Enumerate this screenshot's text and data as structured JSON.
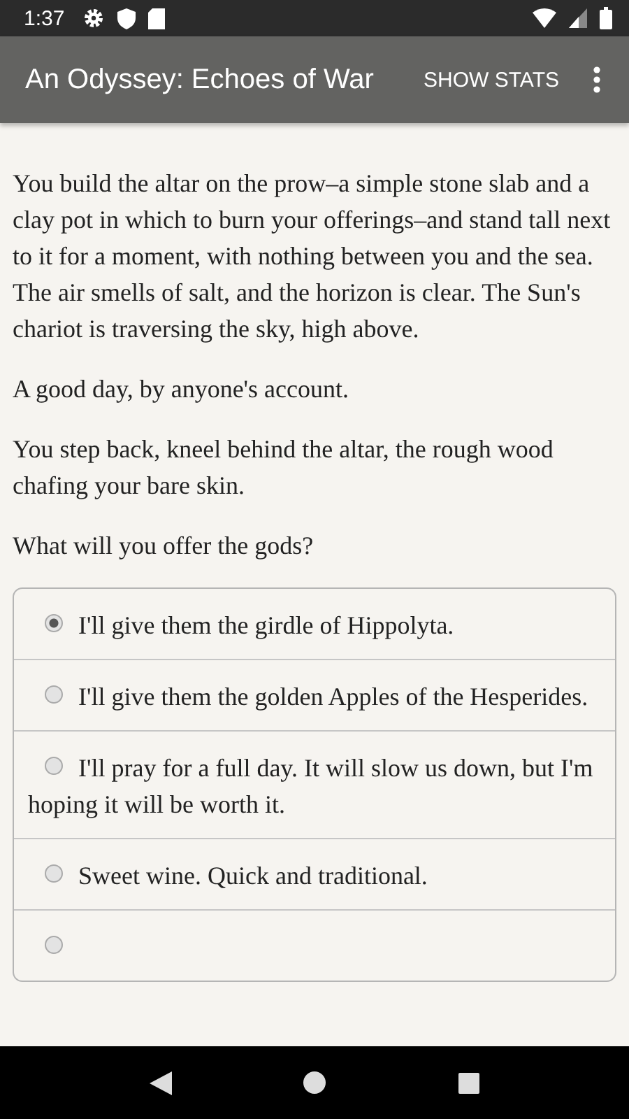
{
  "status_bar": {
    "time": "1:37"
  },
  "app_bar": {
    "title": "An Odyssey: Echoes of War",
    "action": "SHOW STATS"
  },
  "paragraphs": [
    "You build the altar on the prow–a simple stone slab and a clay pot in which to burn your offerings–and stand tall next to it for a moment, with nothing between you and the sea. The air smells of salt, and the horizon is clear. The Sun's chariot is traversing the sky, high above.",
    "A good day, by anyone's account.",
    "You step back, kneel behind the altar, the rough wood chafing your bare skin.",
    "What will you offer the gods?"
  ],
  "options": [
    {
      "label": "I'll give them the girdle of Hippolyta.",
      "selected": true
    },
    {
      "label": "I'll give them the golden Apples of the Hesperides.",
      "selected": false
    },
    {
      "label": "I'll pray for a full day. It will slow us down, but I'm hoping it will be worth it.",
      "selected": false
    },
    {
      "label": "Sweet wine. Quick and traditional.",
      "selected": false
    },
    {
      "selected": false
    }
  ]
}
